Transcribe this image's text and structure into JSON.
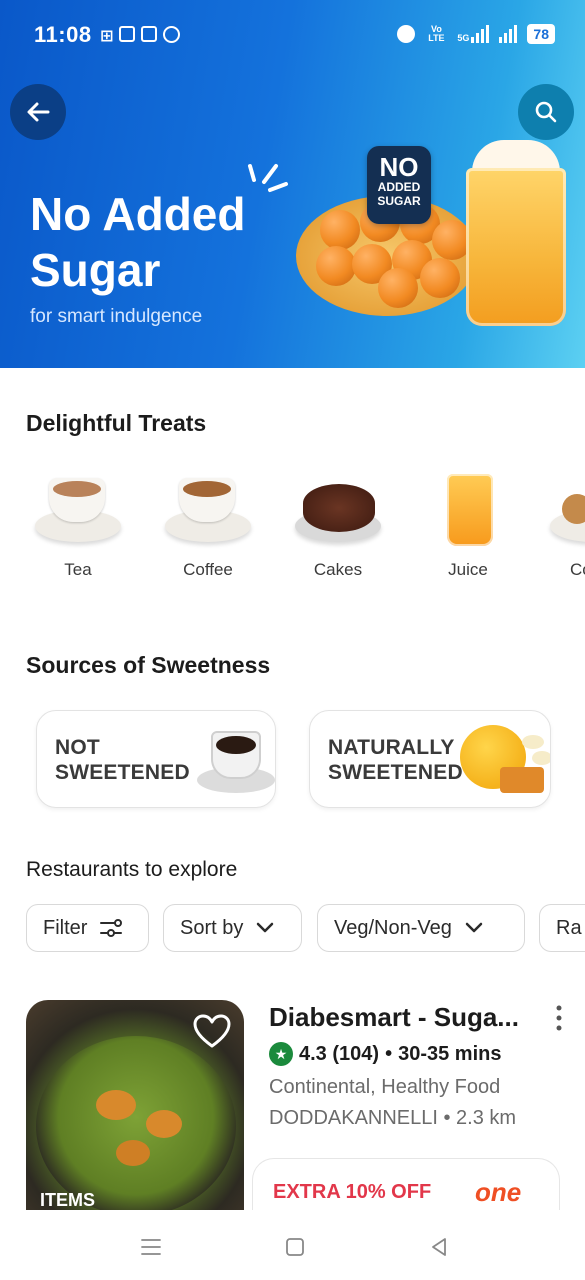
{
  "status_bar": {
    "time": "11:08",
    "battery": "78",
    "network_lte": "Vo LTE",
    "network_5g": "5G"
  },
  "hero": {
    "title_line1": "No Added",
    "title_line2": "Sugar",
    "subtitle": "for smart indulgence",
    "badge_no": "NO",
    "badge_line1": "ADDED",
    "badge_line2": "SUGAR"
  },
  "delightful_treats": {
    "title": "Delightful Treats",
    "items": [
      {
        "label": "Tea",
        "icon": "tea-cup-icon"
      },
      {
        "label": "Coffee",
        "icon": "coffee-cup-icon"
      },
      {
        "label": "Cakes",
        "icon": "cake-icon"
      },
      {
        "label": "Juice",
        "icon": "juice-glass-icon"
      },
      {
        "label": "Co",
        "icon": "cookies-icon"
      }
    ]
  },
  "sources": {
    "title": "Sources of Sweetness",
    "cards": [
      {
        "line1": "NOT",
        "line2": "SWEETENED"
      },
      {
        "line1": "NATURALLY",
        "line2": "SWEETENED"
      }
    ]
  },
  "restaurants": {
    "title": "Restaurants to explore",
    "filters": [
      {
        "label": "Filter"
      },
      {
        "label": "Sort by"
      },
      {
        "label": "Veg/Non-Veg"
      },
      {
        "label": "Ra"
      }
    ],
    "card": {
      "name": "Diabesmart - Suga...",
      "rating": "4.3 (104)",
      "time": "30-35 mins",
      "cuisine": "Continental, Healthy Food",
      "location": "DODDAKANNELLI • 2.3 km",
      "image_tag": "ITEMS",
      "offer": "EXTRA 10% OFF",
      "offer_brand": "one"
    }
  }
}
